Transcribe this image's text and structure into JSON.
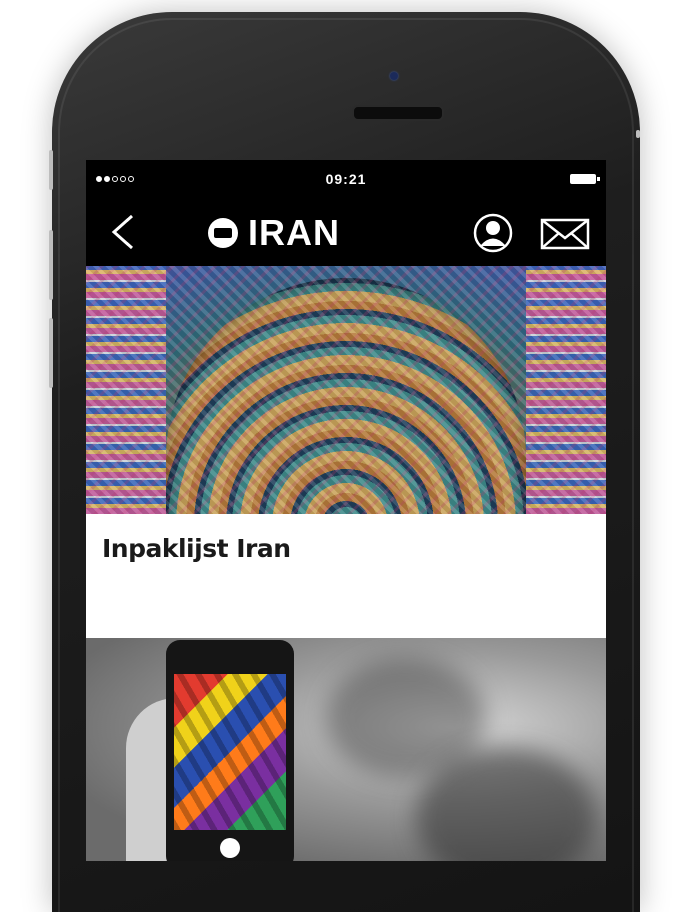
{
  "status_bar": {
    "time": "09:21"
  },
  "nav": {
    "title": "IRAN"
  },
  "cards": [
    {
      "title": "Inpaklijst Iran"
    }
  ],
  "icons": {
    "back": "chevron-left-icon",
    "logo": "logo-icon",
    "user": "user-icon",
    "mail": "mail-icon"
  }
}
